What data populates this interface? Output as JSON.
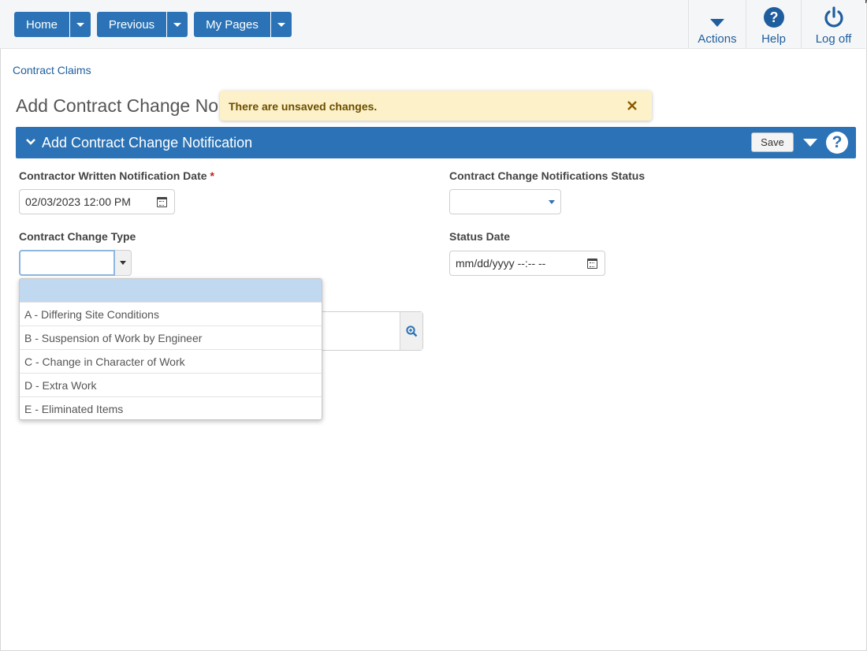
{
  "nav": {
    "home_label": "Home",
    "previous_label": "Previous",
    "mypages_label": "My Pages"
  },
  "tools": {
    "actions_label": "Actions",
    "help_label": "Help",
    "logoff_label": "Log off"
  },
  "breadcrumb": "Contract Claims",
  "page_title": "Add Contract Change No",
  "toast": {
    "message": "There are unsaved changes."
  },
  "panel": {
    "title": "Add Contract Change Notification",
    "save_label": "Save",
    "help_glyph": "?"
  },
  "form": {
    "notification_date": {
      "label": "Contractor Written Notification Date",
      "required_mark": "*",
      "value": "02/03/2023 12:00 PM"
    },
    "status": {
      "label": "Contract Change Notifications Status",
      "value": ""
    },
    "change_type": {
      "label": "Contract Change Type",
      "value": ""
    },
    "status_date": {
      "label": "Status Date",
      "placeholder": "mm/dd/yyyy --:-- --"
    }
  },
  "dropdown": {
    "options": [
      "",
      "A - Differing Site Conditions",
      "B - Suspension of Work by Engineer",
      "C - Change in Character of Work",
      "D - Extra Work",
      "E - Eliminated Items"
    ],
    "selected_index": 0
  },
  "colors": {
    "primary": "#2b73b6",
    "toast_bg": "#fdf1c9",
    "required": "#c0201c"
  }
}
